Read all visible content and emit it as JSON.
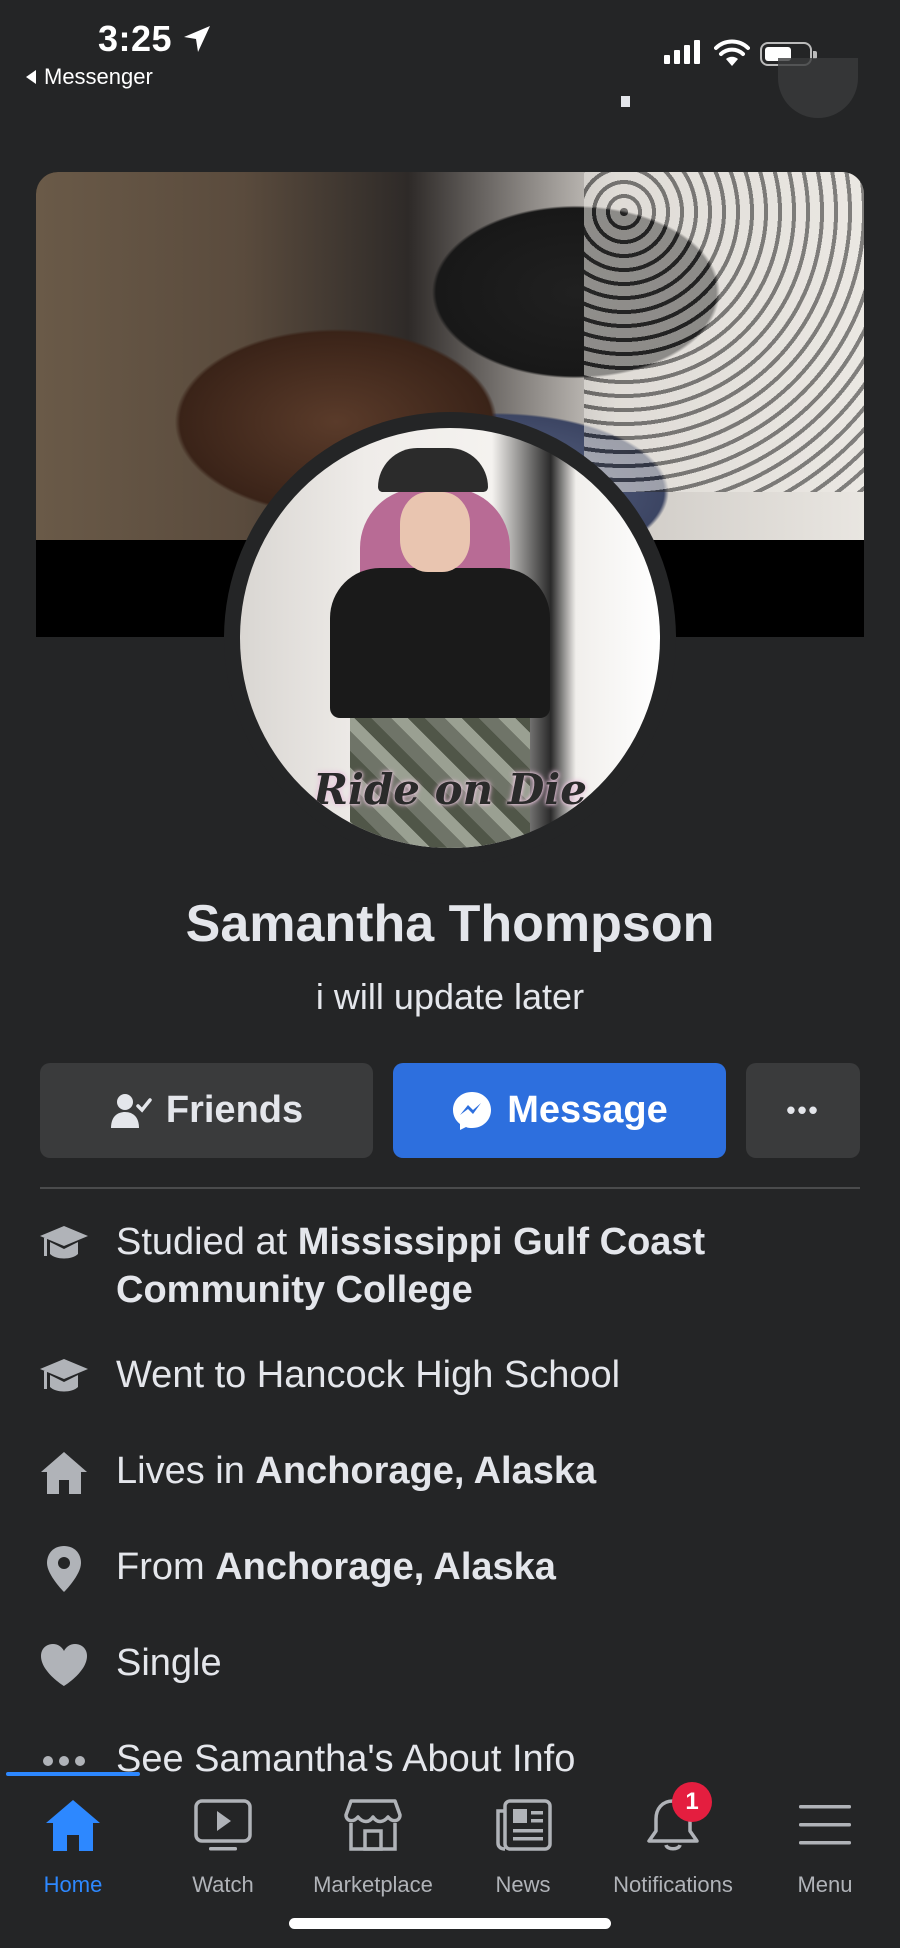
{
  "status_bar": {
    "time": "3:25",
    "back_app": "Messenger"
  },
  "profile": {
    "name": "Samantha Thompson",
    "bio": "i will update later",
    "avatar_caption": "Ride on Die"
  },
  "actions": {
    "friends_label": "Friends",
    "message_label": "Message",
    "more_label": "•••"
  },
  "info": {
    "studied_prefix": "Studied at ",
    "studied_place": "Mississippi Gulf Coast Community College",
    "went_to": "Went to Hancock High School",
    "lives_prefix": "Lives in ",
    "lives_place": "Anchorage, Alaska",
    "from_prefix": "From ",
    "from_place": "Anchorage, Alaska",
    "relationship": "Single",
    "see_about": "See Samantha's About Info"
  },
  "nav": {
    "items": [
      {
        "label": "Home",
        "icon": "home-icon",
        "active": true
      },
      {
        "label": "Watch",
        "icon": "watch-icon"
      },
      {
        "label": "Marketplace",
        "icon": "marketplace-icon"
      },
      {
        "label": "News",
        "icon": "news-icon"
      },
      {
        "label": "Notifications",
        "icon": "bell-icon",
        "badge": "1"
      },
      {
        "label": "Menu",
        "icon": "menu-icon"
      }
    ]
  },
  "colors": {
    "background": "#242526",
    "accent": "#2d6fde",
    "active_nav": "#2d88ff",
    "badge": "#e41e3f"
  }
}
